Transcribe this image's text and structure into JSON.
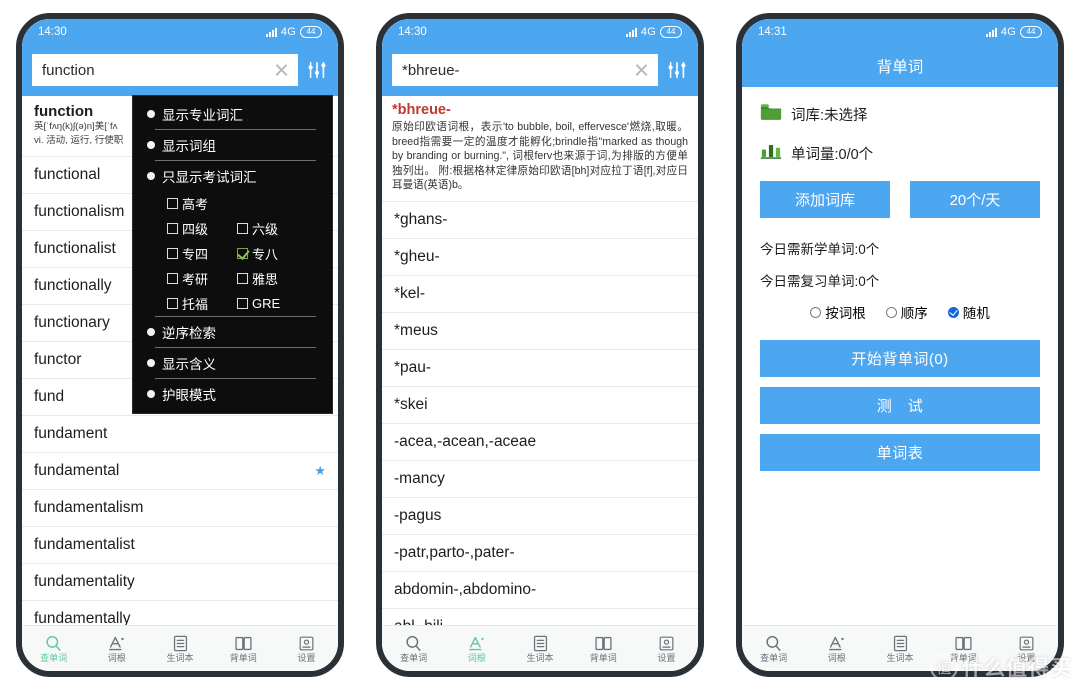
{
  "colors": {
    "header_blue": "#4da6f0",
    "accent_green": "#5cc9a0",
    "star_blue": "#4a9fe0",
    "root_red": "#c0392b",
    "menu_bg": "#0d0d0d"
  },
  "phone1": {
    "status": {
      "time": "14:30",
      "network": "4G",
      "battery": "44"
    },
    "search": {
      "value": "function",
      "placeholder": "",
      "clear_label": "×"
    },
    "entry": {
      "headword": "function",
      "phonetic": "英[ˈfʌŋ(k)ʃ(ə)n]美[ˈfʌ",
      "sense": "vi. 活动, 运行, 行使职"
    },
    "words": [
      {
        "text": "functional",
        "starred": false
      },
      {
        "text": "functionalism",
        "starred": false
      },
      {
        "text": "functionalist",
        "starred": false
      },
      {
        "text": "functionally",
        "starred": false
      },
      {
        "text": "functionary",
        "starred": false
      },
      {
        "text": "functor",
        "starred": false
      },
      {
        "text": "fund",
        "starred": true
      },
      {
        "text": "fundament",
        "starred": false
      },
      {
        "text": "fundamental",
        "starred": true
      },
      {
        "text": "fundamentalism",
        "starred": false
      },
      {
        "text": "fundamentalist",
        "starred": false
      },
      {
        "text": "fundamentality",
        "starred": false
      },
      {
        "text": "fundamentally",
        "starred": false
      }
    ],
    "menu": {
      "items": [
        {
          "label": "显示专业词汇",
          "type": "bullet"
        },
        {
          "label": "显示词组",
          "type": "bullet"
        },
        {
          "label": "只显示考试词汇",
          "type": "bullet"
        }
      ],
      "exam_rows": [
        [
          {
            "label": "高考",
            "checked": false
          }
        ],
        [
          {
            "label": "四级",
            "checked": false
          },
          {
            "label": "六级",
            "checked": false
          }
        ],
        [
          {
            "label": "专四",
            "checked": false
          },
          {
            "label": "专八",
            "checked": true
          }
        ],
        [
          {
            "label": "考研",
            "checked": false
          },
          {
            "label": "雅思",
            "checked": false
          }
        ],
        [
          {
            "label": "托福",
            "checked": false
          },
          {
            "label": "GRE",
            "checked": false
          }
        ]
      ],
      "tail_items": [
        {
          "label": "逆序检索",
          "type": "bullet"
        },
        {
          "label": "显示含义",
          "type": "bullet"
        },
        {
          "label": "护眼模式",
          "type": "bullet"
        }
      ]
    },
    "active_tab": 0
  },
  "phone2": {
    "status": {
      "time": "14:30",
      "network": "4G",
      "battery": "44"
    },
    "search": {
      "value": "*bhreue-",
      "placeholder": "",
      "clear_label": "×"
    },
    "root_entry": {
      "term": "*bhreue-",
      "definition": "原始印欧语词根，表示'to bubble, boil, effervesce'燃烧,取暖。breed指需要一定的温度才能孵化;brindle指\"marked as though by branding or burning.\", 词根ferv也来源于词,为排版的方便单独列出。 附:根据格林定律原始印欧语[bh]对应拉丁语[f],对应日耳曼语(英语)b。"
    },
    "roots": [
      "*ghans-",
      "*gheu-",
      "*kel-",
      "*meus",
      "*pau-",
      "*skei",
      "-acea,-acean,-aceae",
      "-mancy",
      "-pagus",
      "-patr,parto-,pater-",
      "abdomin-,abdomino-",
      "abl-,bili-"
    ],
    "active_tab": 1
  },
  "phone3": {
    "status": {
      "time": "14:31",
      "network": "4G",
      "battery": "44"
    },
    "title": "背单词",
    "library": {
      "icon": "folder-icon",
      "text": "词库:未选择"
    },
    "count": {
      "icon": "bar-chart-icon",
      "text": "单词量:0/0个"
    },
    "buttons": {
      "add_library": "添加词库",
      "per_day": "20个/天"
    },
    "stats": {
      "new_today": "今日需新学单词:0个",
      "review_today": "今日需复习单词:0个"
    },
    "order_options": [
      {
        "label": "按词根",
        "selected": false
      },
      {
        "label": "顺序",
        "selected": false
      },
      {
        "label": "随机",
        "selected": true
      }
    ],
    "actions": [
      "开始背单词(0)",
      "测　试",
      "单词表"
    ],
    "active_tab": -1
  },
  "tabs": [
    {
      "label": "查单词",
      "icon": "search-icon"
    },
    {
      "label": "词根",
      "icon": "letter-a-icon"
    },
    {
      "label": "生词本",
      "icon": "notebook-icon"
    },
    {
      "label": "背单词",
      "icon": "open-book-icon"
    },
    {
      "label": "设置",
      "icon": "gear-icon"
    }
  ],
  "watermark": {
    "mark": "值",
    "text": "什么值得买"
  }
}
